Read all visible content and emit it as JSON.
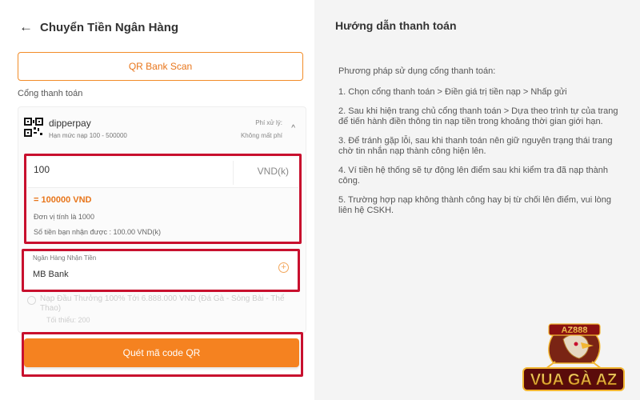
{
  "header": {
    "title": "Chuyển Tiền Ngân Hàng",
    "back_icon": "arrow-left-icon"
  },
  "qr_scan_button": {
    "label": "QR Bank Scan"
  },
  "gateway_section": {
    "label": "Cổng thanh toán",
    "gateway": {
      "name": "dipperpay",
      "limit": "Hạn mức nạp 100 - 500000",
      "fee_label": "Phí xử lý:",
      "fee_value": "Không mất phí",
      "icon": "qr-code-icon"
    }
  },
  "amount": {
    "value": "100",
    "unit": "VND(k)",
    "converted": "= 100000 VND",
    "unit_note": "Đơn vị tính là 1000",
    "received_note": "Số tiền bạn nhận được : 100.00 VND(k)"
  },
  "bank": {
    "label": "Ngân Hàng Nhận Tiền",
    "value": "MB Bank"
  },
  "promo": {
    "text": "Nạp Đầu Thưởng 100% Tới 6.888.000 VND (Đá Gà - Sòng Bài - Thể Thao)",
    "min": "Tối thiểu: 200"
  },
  "submit_button": {
    "label": "Quét mã code QR"
  },
  "guide": {
    "title": "Hướng dẫn thanh toán",
    "intro": "Phương pháp sử dụng cổng thanh toán:",
    "steps": [
      "1. Chọn cổng thanh toán > Điền giá trị tiền nạp > Nhấp gửi",
      "2. Sau khi hiện trang chủ cổng thanh toán > Dựa theo trình tự của trang để tiến hành điền thông tin nạp tiền trong khoảng thời gian giới hạn.",
      "3. Để tránh gặp lỗi, sau khi thanh toán nên giữ nguyên trạng thái trang chờ tin nhắn nạp thành công hiện lên.",
      "4. Ví tiền hệ thống sẽ tự động lên điểm sau khi kiểm tra đã nạp thành công.",
      "5. Trường hợp nạp không thành công hay bị từ chối lên điểm, vui lòng liên hệ CSKH."
    ]
  },
  "brand": {
    "top": "AZ888",
    "main": "VUA GÀ AZ"
  },
  "colors": {
    "accent": "#f58220",
    "highlight": "#c8102e",
    "guide_bg": "#f4f4f4"
  }
}
